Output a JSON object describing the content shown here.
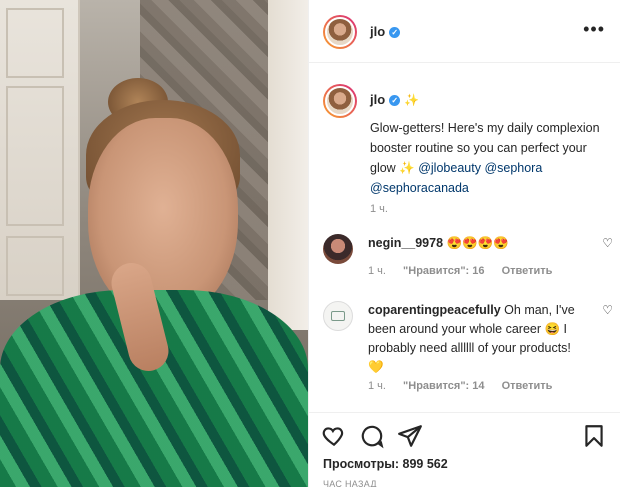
{
  "header": {
    "username": "jlo",
    "more_label": "•••"
  },
  "caption": {
    "username": "jlo",
    "sparkle": "✨",
    "text_1": "Glow-getters! Here's my daily complexion booster routine so you can perfect your glow ✨ ",
    "mention_1": "@jlobeauty",
    "mention_2": "@sephora",
    "mention_3": "@sephoracanada",
    "time": "1 ч."
  },
  "comments": [
    {
      "username": "negin__9978",
      "text": "😍😍😍😍",
      "time": "1 ч.",
      "likes": "\"Нравится\": 16",
      "reply": "Ответить"
    },
    {
      "username": "coparentingpeacefully",
      "text": "Oh man, I've been around your whole career 😆 I probably need allllll of your products! 💛",
      "time": "1 ч.",
      "likes": "\"Нравится\": 14",
      "reply": "Ответить"
    }
  ],
  "footer": {
    "views": "Просмотры: 899 562",
    "ago": "ЧАС НАЗАД"
  },
  "icons": {
    "like": "heart-icon",
    "comment": "comment-icon",
    "share": "share-icon",
    "save": "bookmark-icon"
  },
  "colors": {
    "verified": "#3897f0",
    "mention": "#00376b",
    "muted": "#8e8e8e"
  }
}
